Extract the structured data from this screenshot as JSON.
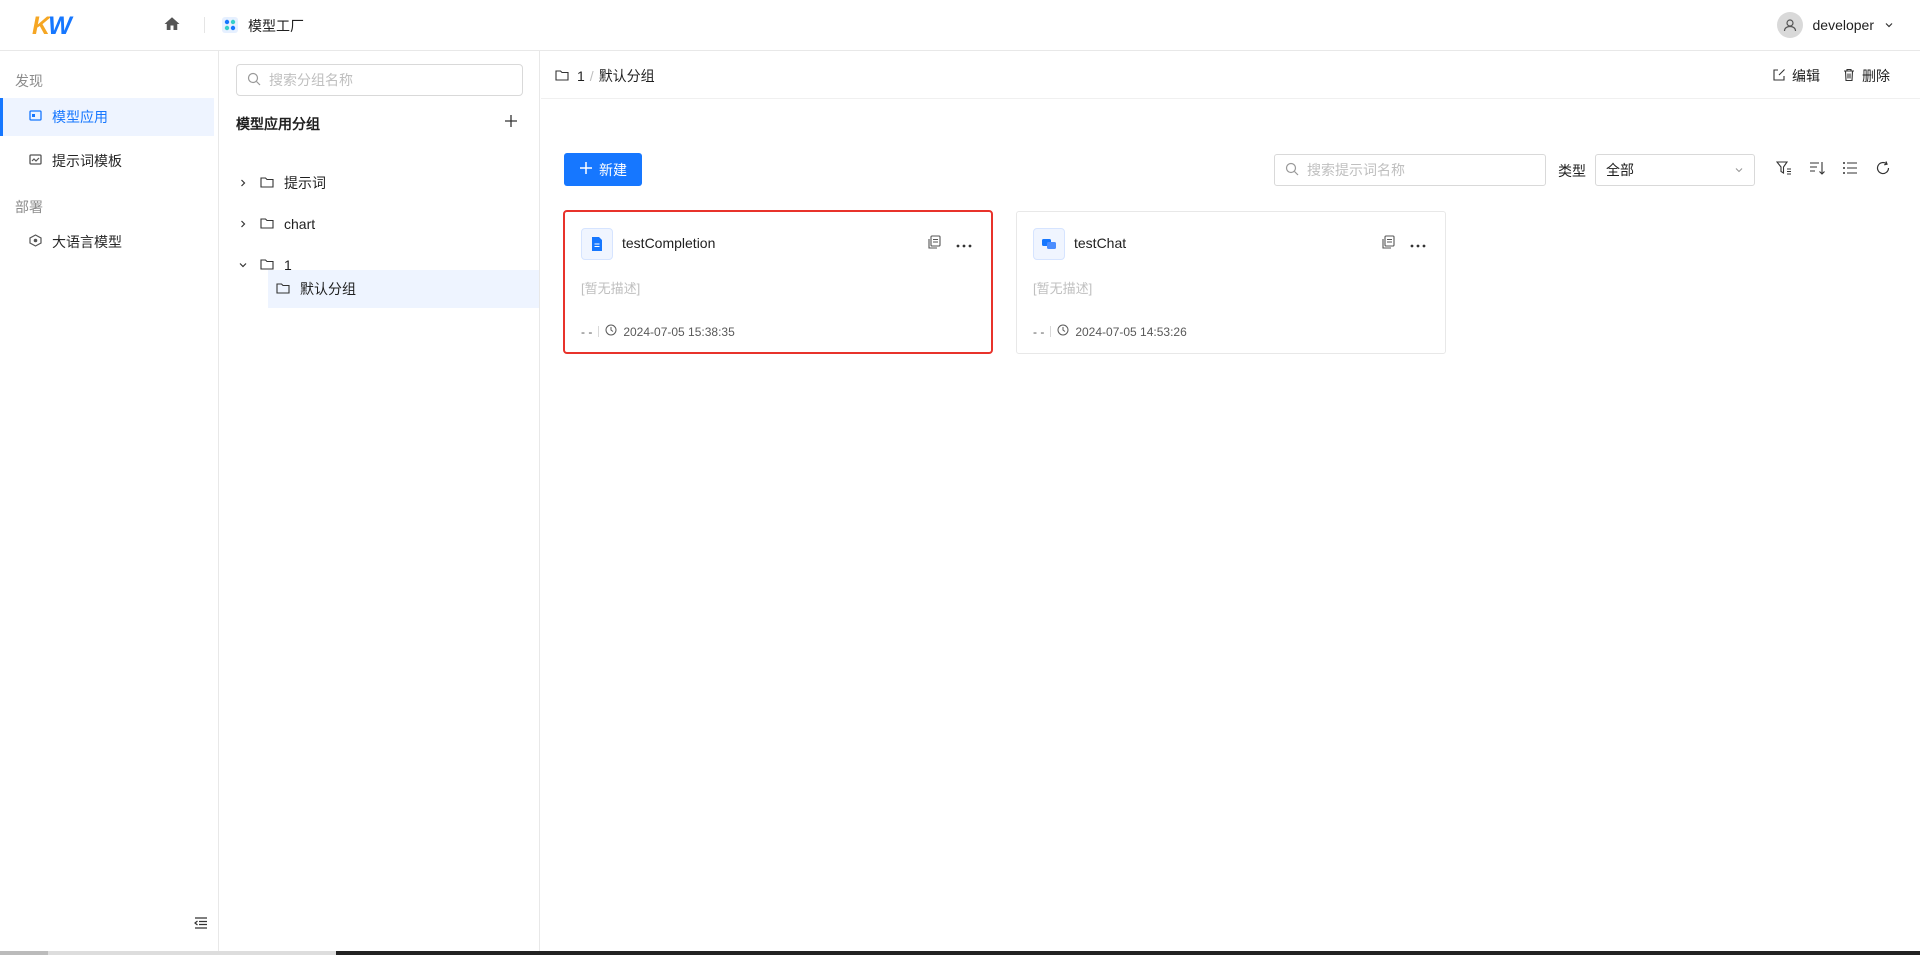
{
  "header": {
    "logo": "KW",
    "app_name": "模型工厂",
    "username": "developer"
  },
  "nav": {
    "sections": [
      {
        "label": "发现",
        "items": [
          {
            "label": "模型应用",
            "active": true,
            "icon": "app-icon"
          },
          {
            "label": "提示词模板",
            "active": false,
            "icon": "template-icon"
          }
        ]
      },
      {
        "label": "部署",
        "items": [
          {
            "label": "大语言模型",
            "active": false,
            "icon": "model-icon"
          }
        ]
      }
    ]
  },
  "tree": {
    "search_placeholder": "搜索分组名称",
    "title": "模型应用分组",
    "nodes": [
      {
        "label": "提示词",
        "expanded": false
      },
      {
        "label": "chart",
        "expanded": false
      },
      {
        "label": "1",
        "expanded": true
      },
      {
        "label": "默认分组",
        "selected": true
      }
    ]
  },
  "main": {
    "breadcrumb": {
      "parent": "1",
      "separator": "/",
      "current": "默认分组"
    },
    "actions": {
      "edit": "编辑",
      "delete": "删除"
    },
    "new_button": "新建",
    "search_placeholder": "搜索提示词名称",
    "type_label": "类型",
    "type_value": "全部",
    "cards": [
      {
        "name": "testCompletion",
        "desc": "[暂无描述]",
        "owner": "- -",
        "time": "2024-07-05 15:38:35",
        "icon": "document-icon",
        "highlighted": true
      },
      {
        "name": "testChat",
        "desc": "[暂无描述]",
        "owner": "- -",
        "time": "2024-07-05 14:53:26",
        "icon": "chat-icon",
        "highlighted": false
      }
    ]
  },
  "colors": {
    "primary": "#1677ff",
    "highlight": "#e8322b",
    "logo_k": "#f5a623"
  }
}
